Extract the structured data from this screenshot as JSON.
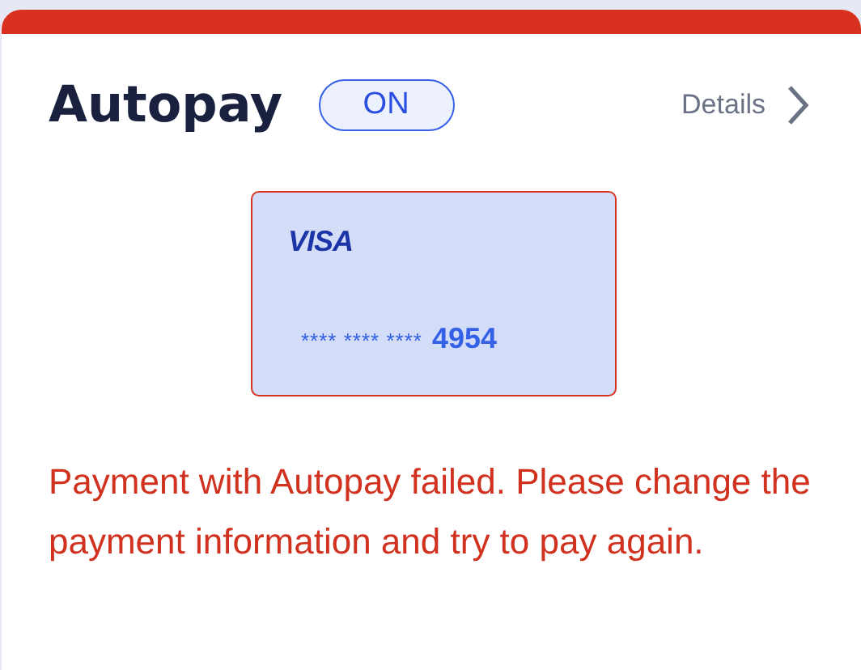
{
  "title": "Autopay",
  "status": {
    "label": "ON",
    "on": true
  },
  "details_link": "Details",
  "payment_card": {
    "brand": "VISA",
    "number_mask": "**** **** ****",
    "last_digits": "4954",
    "error": true
  },
  "message": "Payment with Autopay failed. Please change the payment information and try to pay again."
}
